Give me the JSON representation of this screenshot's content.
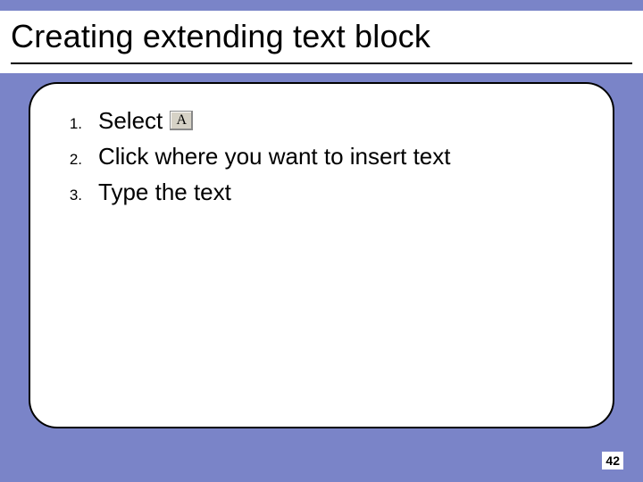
{
  "slide": {
    "title": "Creating extending text block",
    "steps": [
      {
        "num": "1.",
        "text_before": "Select",
        "icon": "A",
        "text_after": ""
      },
      {
        "num": "2.",
        "text_before": "Click where you want to insert text",
        "icon": "",
        "text_after": ""
      },
      {
        "num": "3.",
        "text_before": "Type the text",
        "icon": "",
        "text_after": ""
      }
    ],
    "page_number": "42"
  }
}
